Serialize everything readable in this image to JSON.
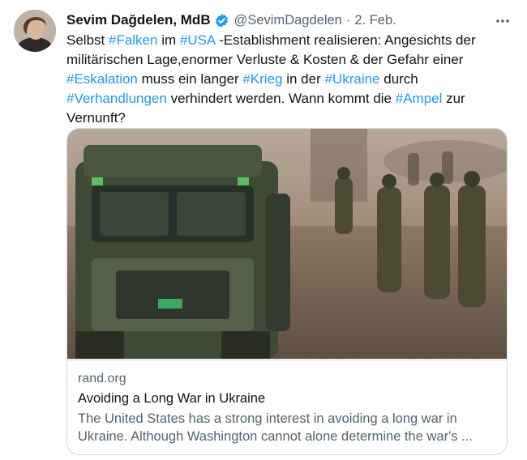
{
  "author": {
    "name": "Sevim Dağdelen, MdB",
    "handle": "@SevimDagdelen",
    "separator": "·",
    "date": "2. Feb."
  },
  "tweet": {
    "segments": [
      {
        "text": "Selbst ",
        "tag": false
      },
      {
        "text": "#Falken",
        "tag": true
      },
      {
        "text": " im ",
        "tag": false
      },
      {
        "text": "#USA",
        "tag": true
      },
      {
        "text": " -Establishment realisieren: Angesichts der militärischen Lage,enormer Verluste & Kosten & der Gefahr einer ",
        "tag": false
      },
      {
        "text": "#Eskalation",
        "tag": true
      },
      {
        "text": " muss ein langer ",
        "tag": false
      },
      {
        "text": "#Krieg",
        "tag": true
      },
      {
        "text": " in der ",
        "tag": false
      },
      {
        "text": "#Ukraine",
        "tag": true
      },
      {
        "text": " durch ",
        "tag": false
      },
      {
        "text": "#Verhandlungen",
        "tag": true
      },
      {
        "text": " verhindert werden. Wann kommt die ",
        "tag": false
      },
      {
        "text": "#Ampel",
        "tag": true
      },
      {
        "text": " zur Vernunft?",
        "tag": false
      }
    ]
  },
  "card": {
    "domain": "rand.org",
    "title": "Avoiding a Long War in Ukraine",
    "description": "The United States has a strong interest in avoiding a long war in Ukraine. Although Washington cannot alone determine the war's ..."
  },
  "colors": {
    "hashtag": "#1d9bf0",
    "verified": "#1d9bf0",
    "secondary_text": "#536471",
    "border": "#cfd9de"
  },
  "icons": {
    "verified": "verified-badge-icon",
    "more": "more-horizontal-icon"
  }
}
